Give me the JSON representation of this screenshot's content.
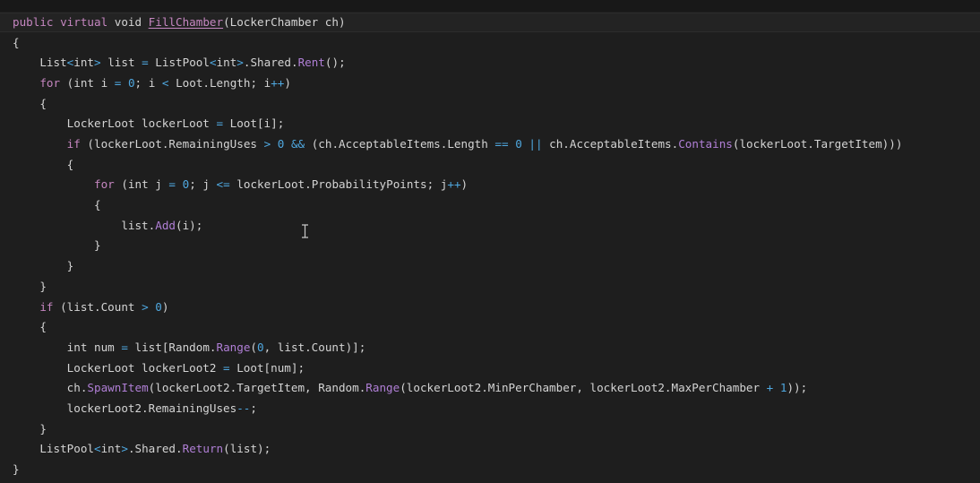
{
  "colors": {
    "background": "#1e1e1e",
    "keyword": "#c586c0",
    "method": "#b07fd6",
    "operator": "#4fa8e0",
    "plain": "#d4d4d4"
  },
  "cursor": {
    "icon": "text-ibeam-cursor-icon"
  },
  "code": {
    "lines": [
      {
        "tokens": [
          {
            "t": "public virtual ",
            "c": "kw"
          },
          {
            "t": "void ",
            "c": "plain"
          },
          {
            "t": "FillChamber",
            "c": "ref"
          },
          {
            "t": "(LockerChamber ch)",
            "c": "plain"
          }
        ],
        "current": true
      },
      {
        "tokens": [
          {
            "t": "{",
            "c": "plain"
          }
        ]
      },
      {
        "tokens": [
          {
            "t": "    List",
            "c": "plain"
          },
          {
            "t": "<",
            "c": "op"
          },
          {
            "t": "int",
            "c": "plain"
          },
          {
            "t": ">",
            "c": "op"
          },
          {
            "t": " list ",
            "c": "plain"
          },
          {
            "t": "=",
            "c": "op"
          },
          {
            "t": " ListPool",
            "c": "plain"
          },
          {
            "t": "<",
            "c": "op"
          },
          {
            "t": "int",
            "c": "plain"
          },
          {
            "t": ">",
            "c": "op"
          },
          {
            "t": ".Shared.",
            "c": "plain"
          },
          {
            "t": "Rent",
            "c": "method"
          },
          {
            "t": "();",
            "c": "plain"
          }
        ]
      },
      {
        "tokens": [
          {
            "t": "    ",
            "c": "plain"
          },
          {
            "t": "for",
            "c": "kw"
          },
          {
            "t": " (int i ",
            "c": "plain"
          },
          {
            "t": "=",
            "c": "op"
          },
          {
            "t": " ",
            "c": "plain"
          },
          {
            "t": "0",
            "c": "num"
          },
          {
            "t": "; i ",
            "c": "plain"
          },
          {
            "t": "<",
            "c": "op"
          },
          {
            "t": " Loot.Length; i",
            "c": "plain"
          },
          {
            "t": "++",
            "c": "op"
          },
          {
            "t": ")",
            "c": "plain"
          }
        ]
      },
      {
        "tokens": [
          {
            "t": "    {",
            "c": "plain"
          }
        ]
      },
      {
        "tokens": [
          {
            "t": "        LockerLoot lockerLoot ",
            "c": "plain"
          },
          {
            "t": "=",
            "c": "op"
          },
          {
            "t": " Loot[i];",
            "c": "plain"
          }
        ]
      },
      {
        "tokens": [
          {
            "t": "        ",
            "c": "plain"
          },
          {
            "t": "if",
            "c": "kw"
          },
          {
            "t": " (lockerLoot.RemainingUses ",
            "c": "plain"
          },
          {
            "t": ">",
            "c": "op"
          },
          {
            "t": " ",
            "c": "plain"
          },
          {
            "t": "0",
            "c": "num"
          },
          {
            "t": " ",
            "c": "plain"
          },
          {
            "t": "&&",
            "c": "op"
          },
          {
            "t": " (ch.AcceptableItems.Length ",
            "c": "plain"
          },
          {
            "t": "==",
            "c": "op"
          },
          {
            "t": " ",
            "c": "plain"
          },
          {
            "t": "0",
            "c": "num"
          },
          {
            "t": " ",
            "c": "plain"
          },
          {
            "t": "||",
            "c": "op"
          },
          {
            "t": " ch.AcceptableItems.",
            "c": "plain"
          },
          {
            "t": "Contains",
            "c": "method"
          },
          {
            "t": "(lockerLoot.TargetItem)))",
            "c": "plain"
          }
        ]
      },
      {
        "tokens": [
          {
            "t": "        {",
            "c": "plain"
          }
        ]
      },
      {
        "tokens": [
          {
            "t": "            ",
            "c": "plain"
          },
          {
            "t": "for",
            "c": "kw"
          },
          {
            "t": " (int j ",
            "c": "plain"
          },
          {
            "t": "=",
            "c": "op"
          },
          {
            "t": " ",
            "c": "plain"
          },
          {
            "t": "0",
            "c": "num"
          },
          {
            "t": "; j ",
            "c": "plain"
          },
          {
            "t": "<=",
            "c": "op"
          },
          {
            "t": " lockerLoot.ProbabilityPoints; j",
            "c": "plain"
          },
          {
            "t": "++",
            "c": "op"
          },
          {
            "t": ")",
            "c": "plain"
          }
        ]
      },
      {
        "tokens": [
          {
            "t": "            {",
            "c": "plain"
          }
        ]
      },
      {
        "tokens": [
          {
            "t": "                list.",
            "c": "plain"
          },
          {
            "t": "Add",
            "c": "method"
          },
          {
            "t": "(i);",
            "c": "plain"
          }
        ]
      },
      {
        "tokens": [
          {
            "t": "            }",
            "c": "plain"
          }
        ]
      },
      {
        "tokens": [
          {
            "t": "        }",
            "c": "plain"
          }
        ]
      },
      {
        "tokens": [
          {
            "t": "    }",
            "c": "plain"
          }
        ]
      },
      {
        "tokens": [
          {
            "t": "    ",
            "c": "plain"
          },
          {
            "t": "if",
            "c": "kw"
          },
          {
            "t": " (list.Count ",
            "c": "plain"
          },
          {
            "t": ">",
            "c": "op"
          },
          {
            "t": " ",
            "c": "plain"
          },
          {
            "t": "0",
            "c": "num"
          },
          {
            "t": ")",
            "c": "plain"
          }
        ]
      },
      {
        "tokens": [
          {
            "t": "    {",
            "c": "plain"
          }
        ]
      },
      {
        "tokens": [
          {
            "t": "        int num ",
            "c": "plain"
          },
          {
            "t": "=",
            "c": "op"
          },
          {
            "t": " list[Random.",
            "c": "plain"
          },
          {
            "t": "Range",
            "c": "method"
          },
          {
            "t": "(",
            "c": "plain"
          },
          {
            "t": "0",
            "c": "num"
          },
          {
            "t": ", list.Count)];",
            "c": "plain"
          }
        ]
      },
      {
        "tokens": [
          {
            "t": "        LockerLoot lockerLoot2 ",
            "c": "plain"
          },
          {
            "t": "=",
            "c": "op"
          },
          {
            "t": " Loot[num];",
            "c": "plain"
          }
        ]
      },
      {
        "tokens": [
          {
            "t": "        ch.",
            "c": "plain"
          },
          {
            "t": "SpawnItem",
            "c": "method"
          },
          {
            "t": "(lockerLoot2.TargetItem, Random.",
            "c": "plain"
          },
          {
            "t": "Range",
            "c": "method"
          },
          {
            "t": "(lockerLoot2.MinPerChamber, lockerLoot2.MaxPerChamber ",
            "c": "plain"
          },
          {
            "t": "+",
            "c": "op"
          },
          {
            "t": " ",
            "c": "plain"
          },
          {
            "t": "1",
            "c": "num"
          },
          {
            "t": "));",
            "c": "plain"
          }
        ]
      },
      {
        "tokens": [
          {
            "t": "        lockerLoot2.RemainingUses",
            "c": "plain"
          },
          {
            "t": "--",
            "c": "op"
          },
          {
            "t": ";",
            "c": "plain"
          }
        ]
      },
      {
        "tokens": [
          {
            "t": "    }",
            "c": "plain"
          }
        ]
      },
      {
        "tokens": [
          {
            "t": "    ListPool",
            "c": "plain"
          },
          {
            "t": "<",
            "c": "op"
          },
          {
            "t": "int",
            "c": "plain"
          },
          {
            "t": ">",
            "c": "op"
          },
          {
            "t": ".Shared.",
            "c": "plain"
          },
          {
            "t": "Return",
            "c": "method"
          },
          {
            "t": "(list);",
            "c": "plain"
          }
        ]
      },
      {
        "tokens": [
          {
            "t": "}",
            "c": "plain"
          }
        ]
      }
    ]
  }
}
